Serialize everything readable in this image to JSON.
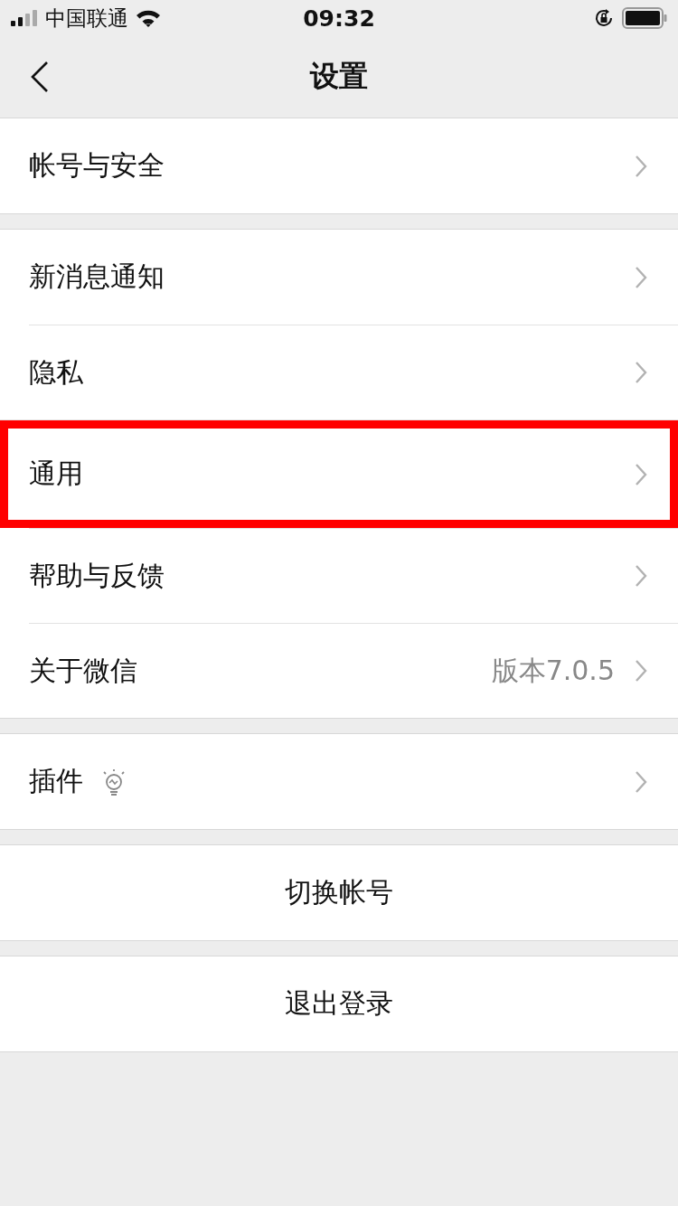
{
  "status_bar": {
    "carrier": "中国联通",
    "time": "09:32"
  },
  "nav": {
    "title": "设置"
  },
  "groups": [
    {
      "items": [
        {
          "label": "帐号与安全",
          "kind": "link",
          "highlighted": false
        }
      ]
    },
    {
      "items": [
        {
          "label": "新消息通知",
          "kind": "link",
          "highlighted": false
        },
        {
          "label": "隐私",
          "kind": "link",
          "highlighted": false
        },
        {
          "label": "通用",
          "kind": "link",
          "highlighted": true
        },
        {
          "label": "帮助与反馈",
          "kind": "link",
          "highlighted": false
        },
        {
          "label": "关于微信",
          "kind": "link",
          "highlighted": false,
          "detail": "版本7.0.5"
        }
      ]
    },
    {
      "items": [
        {
          "label": "插件",
          "kind": "bulb",
          "highlighted": false
        }
      ]
    }
  ],
  "actions": [
    "切换帐号",
    "退出登录"
  ]
}
